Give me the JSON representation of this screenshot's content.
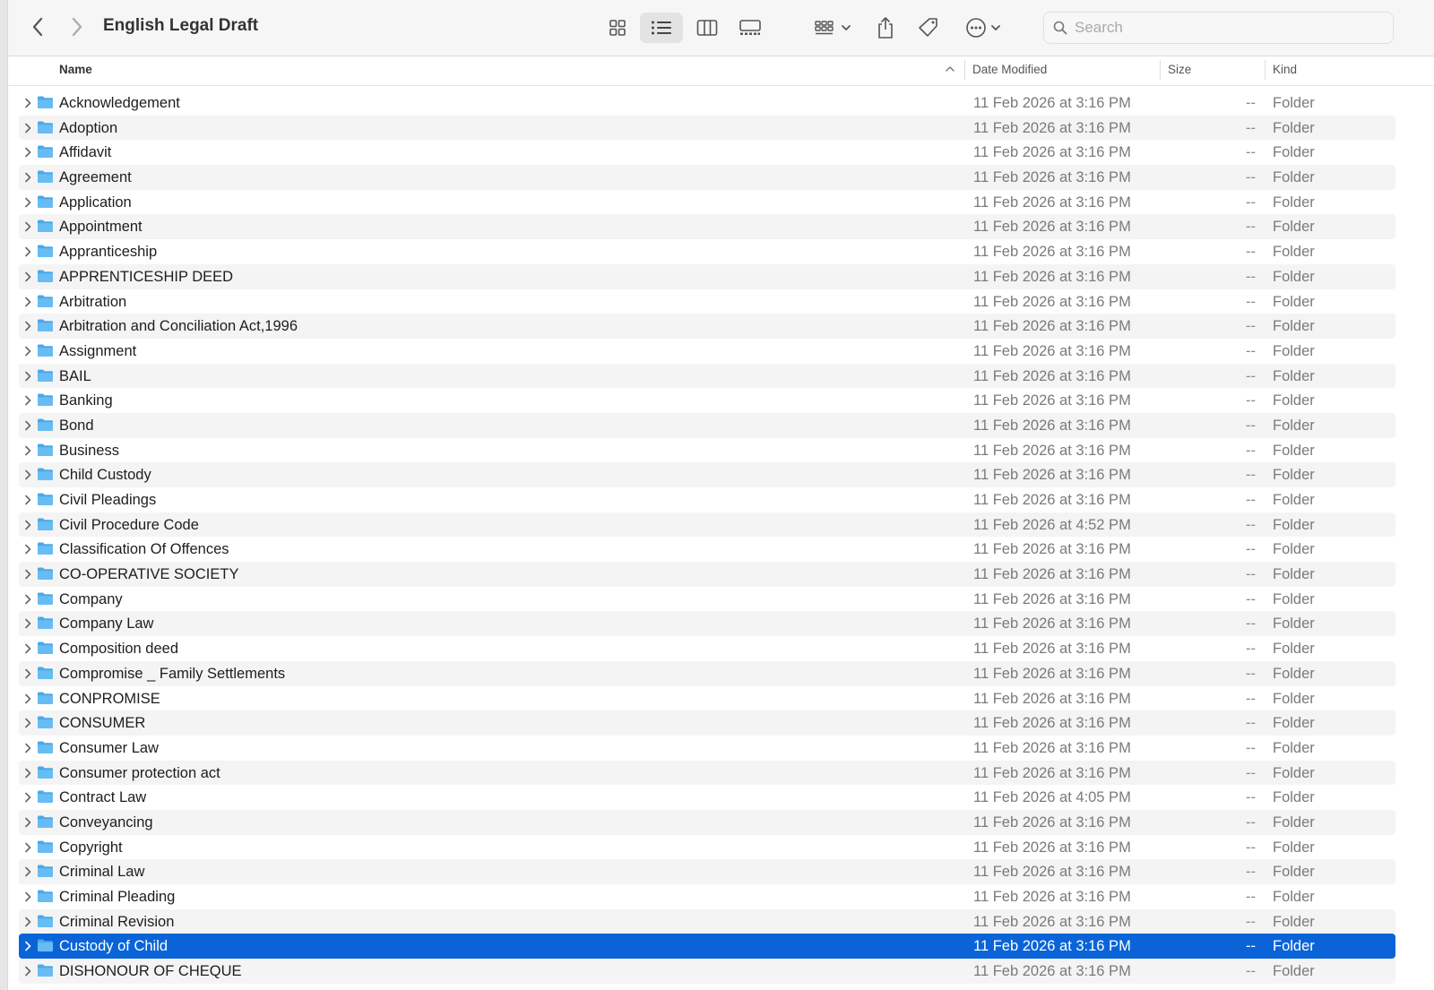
{
  "window": {
    "title": "English Legal Draft"
  },
  "toolbar": {
    "back_icon": "chevron-left-icon",
    "forward_icon": "chevron-right-icon",
    "view_icons": [
      "grid-view-icon",
      "list-view-icon",
      "column-view-icon",
      "gallery-view-icon"
    ],
    "active_view": "list",
    "group_icon": "group-by-icon",
    "share_icon": "share-icon",
    "tag_icon": "tag-icon",
    "more_icon": "more-actions-icon"
  },
  "search": {
    "placeholder": "Search",
    "value": ""
  },
  "columns": {
    "name": "Name",
    "date": "Date Modified",
    "size": "Size",
    "kind": "Kind"
  },
  "colors": {
    "selection": "#0a64d8",
    "folder": "#5ab4ee",
    "stripe": "#f4f4f4"
  },
  "rows": [
    {
      "name": "Acknowledgement",
      "date": "11 Feb 2026 at 3:16 PM",
      "size": "--",
      "kind": "Folder"
    },
    {
      "name": "Adoption",
      "date": "11 Feb 2026 at 3:16 PM",
      "size": "--",
      "kind": "Folder"
    },
    {
      "name": "Affidavit",
      "date": "11 Feb 2026 at 3:16 PM",
      "size": "--",
      "kind": "Folder"
    },
    {
      "name": "Agreement",
      "date": "11 Feb 2026 at 3:16 PM",
      "size": "--",
      "kind": "Folder"
    },
    {
      "name": "Application",
      "date": "11 Feb 2026 at 3:16 PM",
      "size": "--",
      "kind": "Folder"
    },
    {
      "name": "Appointment",
      "date": "11 Feb 2026 at 3:16 PM",
      "size": "--",
      "kind": "Folder"
    },
    {
      "name": "Appranticeship",
      "date": "11 Feb 2026 at 3:16 PM",
      "size": "--",
      "kind": "Folder"
    },
    {
      "name": "APPRENTICESHIP DEED",
      "date": "11 Feb 2026 at 3:16 PM",
      "size": "--",
      "kind": "Folder"
    },
    {
      "name": "Arbitration",
      "date": "11 Feb 2026 at 3:16 PM",
      "size": "--",
      "kind": "Folder"
    },
    {
      "name": "Arbitration and Conciliation Act,1996",
      "date": "11 Feb 2026 at 3:16 PM",
      "size": "--",
      "kind": "Folder"
    },
    {
      "name": "Assignment",
      "date": "11 Feb 2026 at 3:16 PM",
      "size": "--",
      "kind": "Folder"
    },
    {
      "name": "BAIL",
      "date": "11 Feb 2026 at 3:16 PM",
      "size": "--",
      "kind": "Folder"
    },
    {
      "name": "Banking",
      "date": "11 Feb 2026 at 3:16 PM",
      "size": "--",
      "kind": "Folder"
    },
    {
      "name": "Bond",
      "date": "11 Feb 2026 at 3:16 PM",
      "size": "--",
      "kind": "Folder"
    },
    {
      "name": "Business",
      "date": "11 Feb 2026 at 3:16 PM",
      "size": "--",
      "kind": "Folder"
    },
    {
      "name": "Child Custody",
      "date": "11 Feb 2026 at 3:16 PM",
      "size": "--",
      "kind": "Folder"
    },
    {
      "name": "Civil Pleadings",
      "date": "11 Feb 2026 at 3:16 PM",
      "size": "--",
      "kind": "Folder"
    },
    {
      "name": "Civil Procedure Code",
      "date": "11 Feb 2026 at 4:52 PM",
      "size": "--",
      "kind": "Folder"
    },
    {
      "name": "Classification Of Offences",
      "date": "11 Feb 2026 at 3:16 PM",
      "size": "--",
      "kind": "Folder"
    },
    {
      "name": "CO-OPERATIVE SOCIETY",
      "date": "11 Feb 2026 at 3:16 PM",
      "size": "--",
      "kind": "Folder"
    },
    {
      "name": "Company",
      "date": "11 Feb 2026 at 3:16 PM",
      "size": "--",
      "kind": "Folder"
    },
    {
      "name": "Company Law",
      "date": "11 Feb 2026 at 3:16 PM",
      "size": "--",
      "kind": "Folder"
    },
    {
      "name": "Composition deed",
      "date": "11 Feb 2026 at 3:16 PM",
      "size": "--",
      "kind": "Folder"
    },
    {
      "name": "Compromise _ Family Settlements",
      "date": "11 Feb 2026 at 3:16 PM",
      "size": "--",
      "kind": "Folder"
    },
    {
      "name": "CONPROMISE",
      "date": "11 Feb 2026 at 3:16 PM",
      "size": "--",
      "kind": "Folder"
    },
    {
      "name": "CONSUMER",
      "date": "11 Feb 2026 at 3:16 PM",
      "size": "--",
      "kind": "Folder"
    },
    {
      "name": "Consumer Law",
      "date": "11 Feb 2026 at 3:16 PM",
      "size": "--",
      "kind": "Folder"
    },
    {
      "name": "Consumer protection act",
      "date": "11 Feb 2026 at 3:16 PM",
      "size": "--",
      "kind": "Folder"
    },
    {
      "name": "Contract Law",
      "date": "11 Feb 2026 at 4:05 PM",
      "size": "--",
      "kind": "Folder"
    },
    {
      "name": "Conveyancing",
      "date": "11 Feb 2026 at 3:16 PM",
      "size": "--",
      "kind": "Folder"
    },
    {
      "name": "Copyright",
      "date": "11 Feb 2026 at 3:16 PM",
      "size": "--",
      "kind": "Folder"
    },
    {
      "name": "Criminal Law",
      "date": "11 Feb 2026 at 3:16 PM",
      "size": "--",
      "kind": "Folder"
    },
    {
      "name": "Criminal Pleading",
      "date": "11 Feb 2026 at 3:16 PM",
      "size": "--",
      "kind": "Folder"
    },
    {
      "name": "Criminal Revision",
      "date": "11 Feb 2026 at 3:16 PM",
      "size": "--",
      "kind": "Folder"
    },
    {
      "name": "Custody of Child",
      "date": "11 Feb 2026 at 3:16 PM",
      "size": "--",
      "kind": "Folder",
      "selected": true
    },
    {
      "name": "DISHONOUR OF CHEQUE",
      "date": "11 Feb 2026 at 3:16 PM",
      "size": "--",
      "kind": "Folder"
    }
  ]
}
